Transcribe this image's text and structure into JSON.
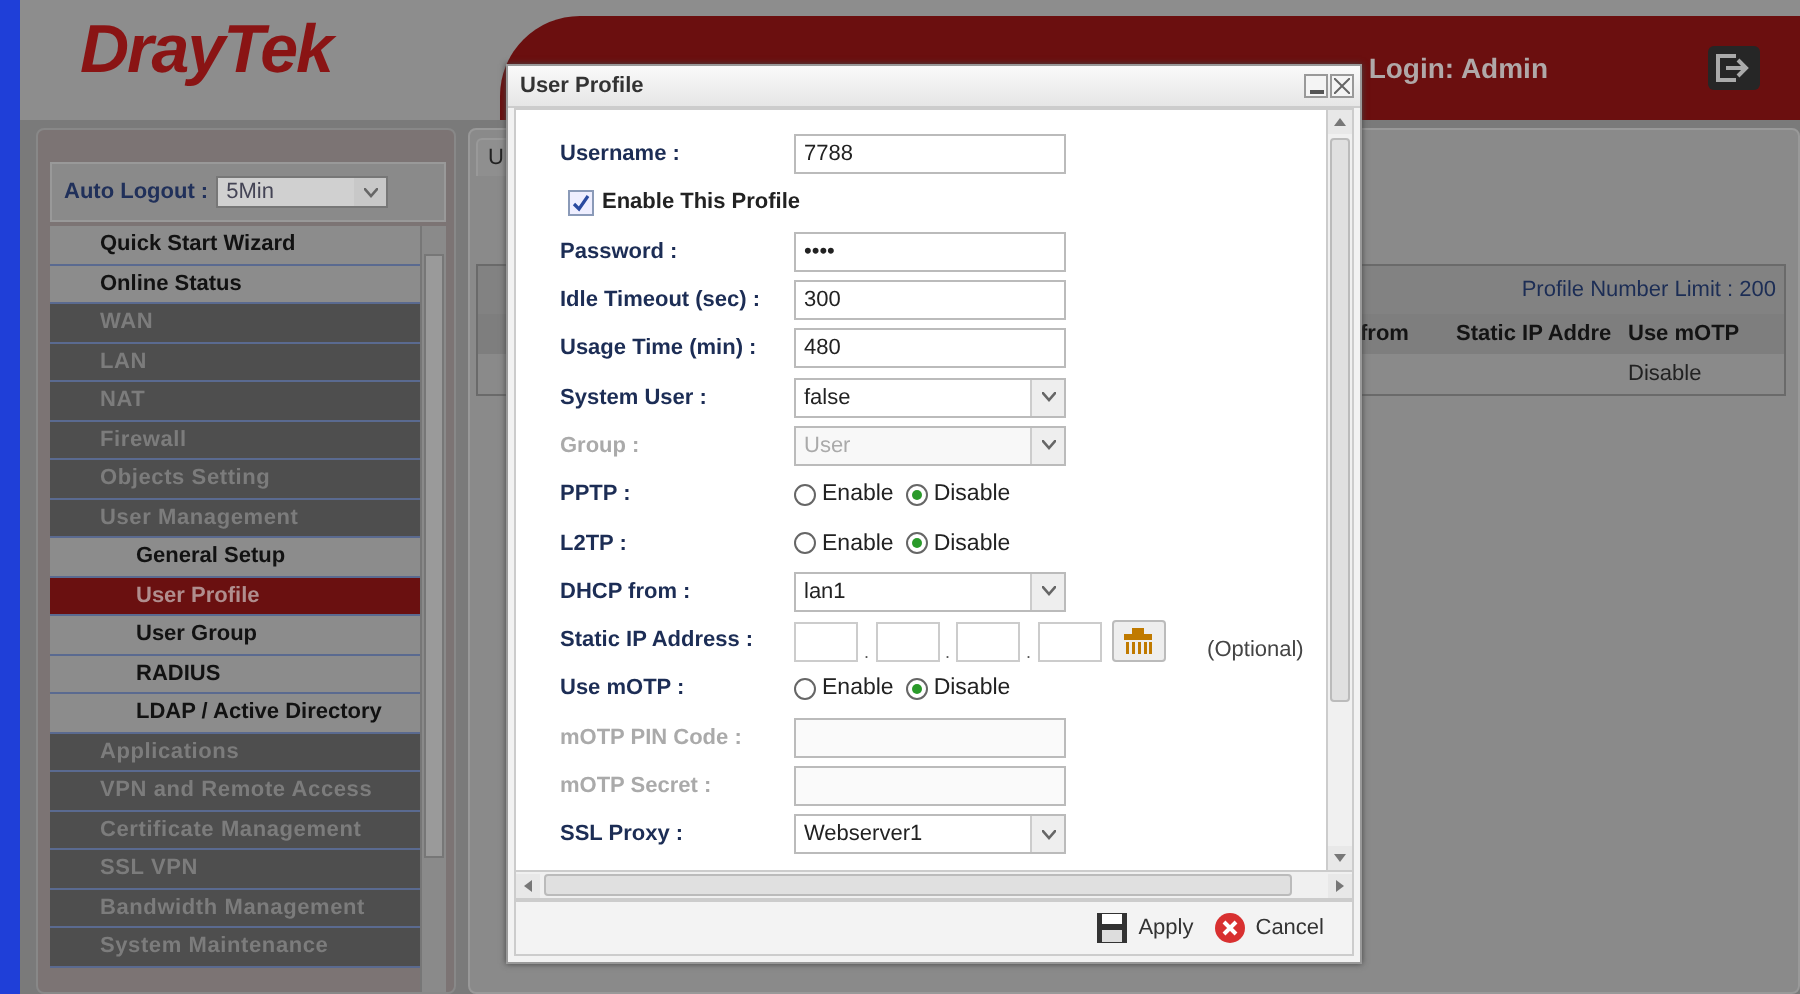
{
  "header": {
    "logo": "DrayTek",
    "login": "Login: Admin"
  },
  "auto_logout": {
    "label": "Auto Logout :",
    "value": "5Min"
  },
  "sidebar": {
    "items": [
      {
        "label": "Quick Start Wizard",
        "kind": "top",
        "selected": false
      },
      {
        "label": "Online Status",
        "kind": "top",
        "selected": false
      },
      {
        "label": "WAN",
        "kind": "section",
        "selected": false
      },
      {
        "label": "LAN",
        "kind": "section",
        "selected": false
      },
      {
        "label": "NAT",
        "kind": "section",
        "selected": false
      },
      {
        "label": "Firewall",
        "kind": "section",
        "selected": false
      },
      {
        "label": "Objects Setting",
        "kind": "section",
        "selected": false
      },
      {
        "label": "User Management",
        "kind": "section",
        "selected": false
      },
      {
        "label": "General Setup",
        "kind": "sub",
        "selected": false
      },
      {
        "label": "User Profile",
        "kind": "sub",
        "selected": true
      },
      {
        "label": "User Group",
        "kind": "sub",
        "selected": false
      },
      {
        "label": "RADIUS",
        "kind": "sub",
        "selected": false
      },
      {
        "label": "LDAP / Active Directory",
        "kind": "sub",
        "selected": false
      },
      {
        "label": "Applications",
        "kind": "section",
        "selected": false
      },
      {
        "label": "VPN and Remote Access",
        "kind": "section",
        "selected": false
      },
      {
        "label": "Certificate Management",
        "kind": "section",
        "selected": false
      },
      {
        "label": "SSL VPN",
        "kind": "section",
        "selected": false
      },
      {
        "label": "Bandwidth Management",
        "kind": "section",
        "selected": false
      },
      {
        "label": "System Maintenance",
        "kind": "section",
        "selected": false
      }
    ]
  },
  "main": {
    "tab": "U",
    "limit": "Profile Number Limit :  200",
    "columns": [
      "from",
      "Static IP Addre",
      "Use mOTP"
    ],
    "rows": [
      [
        "",
        "",
        "Disable"
      ]
    ]
  },
  "dialog": {
    "title": "User Profile",
    "rows": [
      {
        "kind": "text",
        "label": "Username :",
        "value": "7788",
        "disabled": false
      },
      {
        "kind": "checkbox",
        "label": "Enable This Profile",
        "checked": true
      },
      {
        "kind": "password",
        "label": "Password :",
        "value": "••••",
        "disabled": false
      },
      {
        "kind": "text",
        "label": "Idle Timeout (sec) :",
        "value": "300",
        "disabled": false
      },
      {
        "kind": "text",
        "label": "Usage Time (min) :",
        "value": "480",
        "disabled": false
      },
      {
        "kind": "select",
        "label": "System User :",
        "value": "false",
        "disabled": false
      },
      {
        "kind": "select",
        "label": "Group :",
        "value": "User",
        "disabled": true
      },
      {
        "kind": "radio",
        "label": "PPTP :",
        "options": [
          {
            "label": "Enable",
            "selected": false
          },
          {
            "label": "Disable",
            "selected": true
          }
        ]
      },
      {
        "kind": "radio",
        "label": "L2TP :",
        "options": [
          {
            "label": "Enable",
            "selected": false
          },
          {
            "label": "Disable",
            "selected": true
          }
        ]
      },
      {
        "kind": "select",
        "label": "DHCP from :",
        "value": "lan1",
        "disabled": false
      },
      {
        "kind": "ip",
        "label": "Static IP Address :",
        "separators": [
          ".",
          ".",
          "."
        ],
        "note": "(Optional)"
      },
      {
        "kind": "radio",
        "label": "Use mOTP :",
        "options": [
          {
            "label": "Enable",
            "selected": false
          },
          {
            "label": "Disable",
            "selected": true
          }
        ]
      },
      {
        "kind": "text",
        "label": "mOTP PIN Code :",
        "value": "",
        "disabled": true
      },
      {
        "kind": "text",
        "label": "mOTP Secret :",
        "value": "",
        "disabled": true
      },
      {
        "kind": "select",
        "label": "SSL Proxy :",
        "value": "Webserver1",
        "disabled": false
      }
    ],
    "buttons": [
      "Apply",
      "Cancel"
    ]
  }
}
